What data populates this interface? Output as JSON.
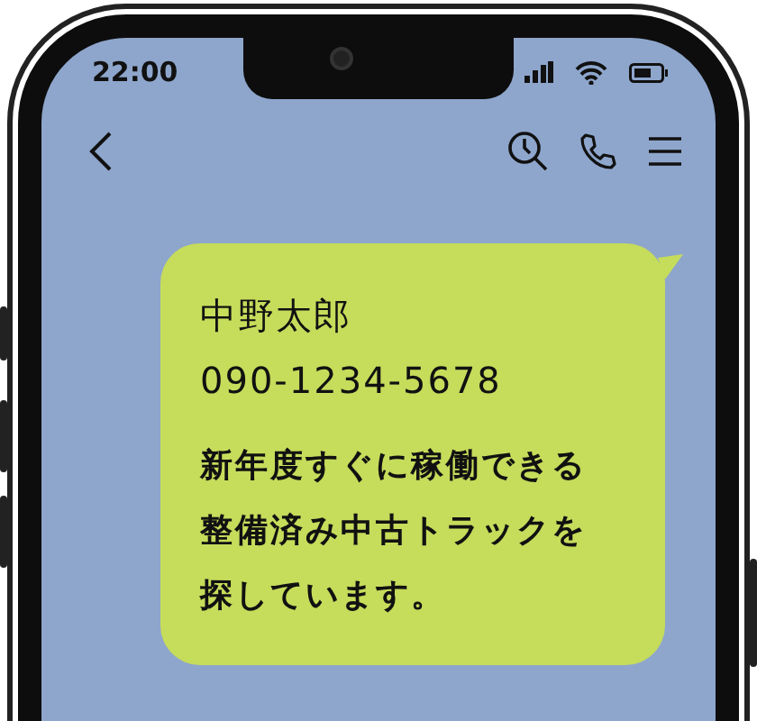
{
  "status_bar": {
    "time": "22:00"
  },
  "message": {
    "name": "中野太郎",
    "phone": "090-1234-5678",
    "body": "新年度すぐに稼働できる整備済み中古トラックを探しています。"
  }
}
